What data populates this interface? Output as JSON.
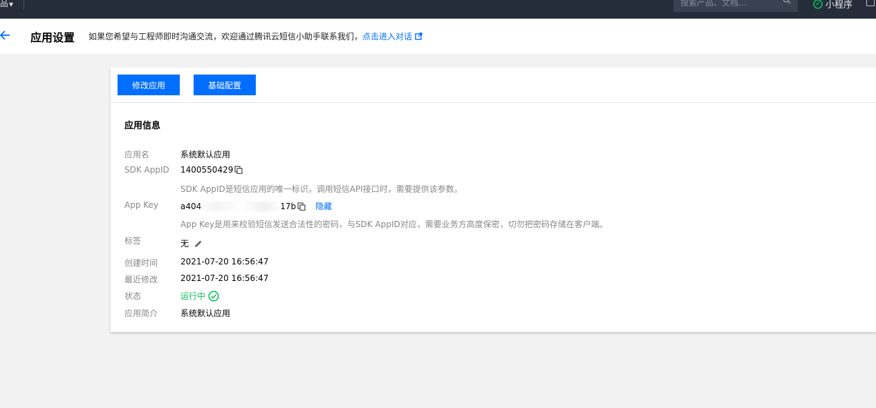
{
  "topbar": {
    "partial_left": "品",
    "search_placeholder": "搜索产品、文档...",
    "mini_program": "小程序"
  },
  "header": {
    "title": "应用设置",
    "hint": "如果您希望与工程师即时沟通交流，欢迎通过腾讯云短信小助手联系我们，",
    "hint_link": "点击进入对话"
  },
  "toolbar": {
    "edit_label": "修改应用",
    "config_label": "基础配置"
  },
  "app_info": {
    "title": "应用信息",
    "name_label": "应用名",
    "name_value": "系统默认应用",
    "appid_label": "SDK AppID",
    "appid_value": "1400550429",
    "appid_note": "SDK AppID是短信应用的唯一标识，调用短信API接口时，需要提供该参数。",
    "appkey_label": "App Key",
    "appkey_prefix": "a404",
    "appkey_suffix": "17b",
    "appkey_hide": "隐藏",
    "appkey_note": "App Key是用来校验短信发送合法性的密码，与SDK AppID对应，需要业务方高度保密，切勿把密码存储在客户端。",
    "tag_label": "标签",
    "tag_value": "无",
    "created_label": "创建时间",
    "created_value": "2021-07-20 16:56:47",
    "modified_label": "最近修改",
    "modified_value": "2021-07-20 16:56:47",
    "status_label": "状态",
    "status_value": "运行中",
    "desc_label": "应用简介",
    "desc_value": "系统默认应用"
  },
  "colors": {
    "primary": "#006eff",
    "success": "#0abf5b",
    "topbar": "#262d3a"
  }
}
